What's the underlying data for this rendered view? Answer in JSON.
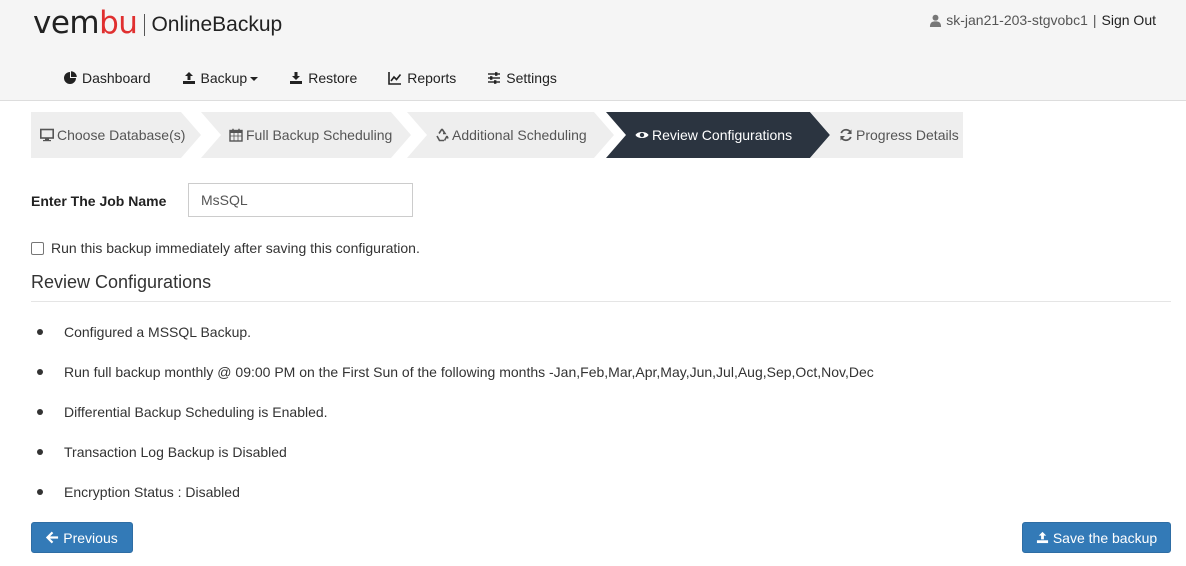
{
  "brand": {
    "logo_prefix": "vem",
    "logo_accent": "bu",
    "product": "OnlineBackup",
    "accent_color": "#e03030"
  },
  "user": {
    "icon": "user-icon",
    "name": "sk-jan21-203-stgvobc1",
    "separator": "|",
    "sign_out": "Sign Out"
  },
  "nav": {
    "dashboard": "Dashboard",
    "backup": "Backup",
    "restore": "Restore",
    "reports": "Reports",
    "settings": "Settings"
  },
  "steps": [
    {
      "label": "Choose Database(s)",
      "icon": "monitor-icon",
      "active": false
    },
    {
      "label": "Full Backup Scheduling",
      "icon": "calendar-icon",
      "active": false
    },
    {
      "label": "Additional Scheduling",
      "icon": "recycle-icon",
      "active": false
    },
    {
      "label": "Review Configurations",
      "icon": "eye-icon",
      "active": true
    },
    {
      "label": "Progress Details",
      "icon": "refresh-icon",
      "active": false
    }
  ],
  "form": {
    "job_label": "Enter The Job Name",
    "job_value": "MsSQL",
    "run_immediately_label": "Run this backup immediately after saving this configuration.",
    "run_immediately_checked": false
  },
  "review": {
    "title": "Review Configurations",
    "items": [
      "Configured a MSSQL Backup.",
      "Run full backup monthly @ 09:00 PM on the First Sun of the following months -Jan,Feb,Mar,Apr,May,Jun,Jul,Aug,Sep,Oct,Nov,Dec",
      "Differential Backup Scheduling is Enabled.",
      "Transaction Log Backup is Disabled",
      "Encryption Status : Disabled"
    ]
  },
  "buttons": {
    "previous": "Previous",
    "save": "Save the backup",
    "primary_color": "#337ab7"
  },
  "colors": {
    "active_step": "#2b3440",
    "inactive_step": "#eeeeee"
  }
}
